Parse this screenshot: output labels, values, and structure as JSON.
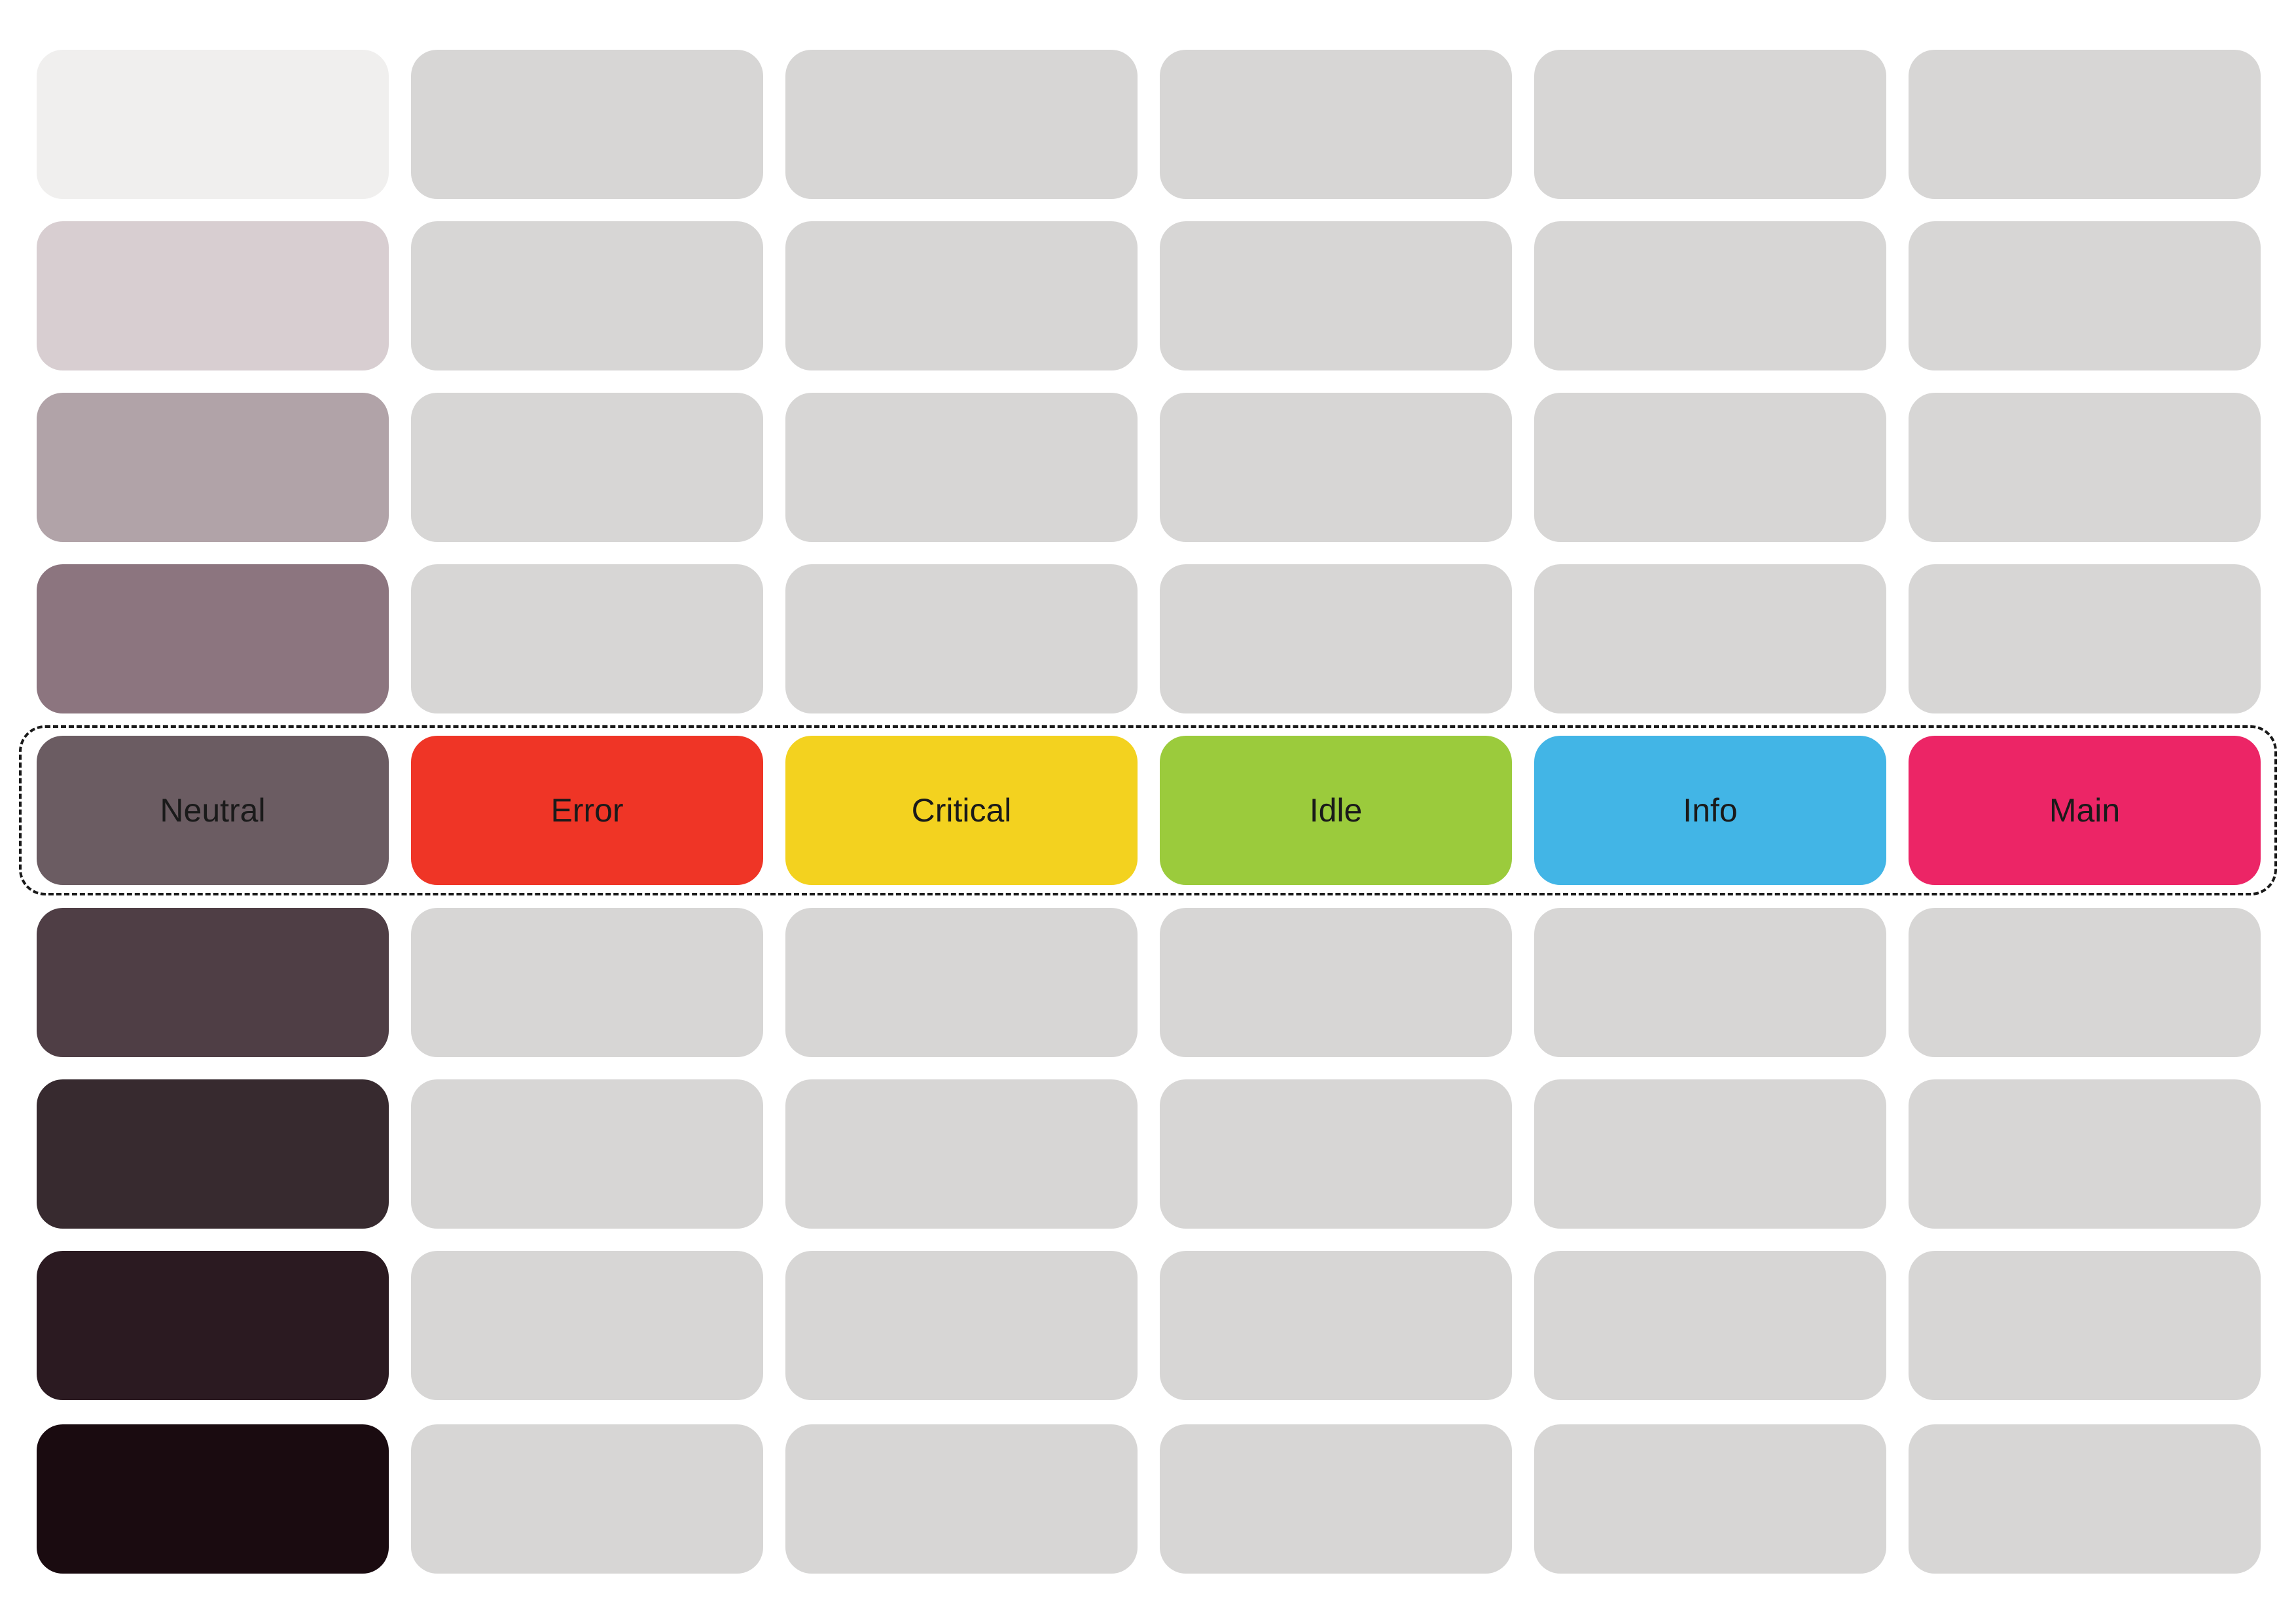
{
  "columns": [
    {
      "id": "neutral",
      "label": "Neutral",
      "shades": [
        "#f0efee",
        "#d8ced1",
        "#b1a3a8",
        "#8c757f",
        "#6b5c62",
        "#4f3e45",
        "#372a2f",
        "#2b1a21",
        "#1a0b10"
      ]
    },
    {
      "id": "error",
      "label": "Error",
      "shades": [
        "#d7d6d5",
        "#d7d6d5",
        "#d7d6d5",
        "#d7d6d5",
        "#ef3526",
        "#d7d6d5",
        "#d7d6d5",
        "#d7d6d5",
        "#d7d6d5"
      ]
    },
    {
      "id": "critical",
      "label": "Critical",
      "shades": [
        "#d7d6d5",
        "#d7d6d5",
        "#d7d6d5",
        "#d7d6d5",
        "#f3d21f",
        "#d7d6d5",
        "#d7d6d5",
        "#d7d6d5",
        "#d7d6d5"
      ]
    },
    {
      "id": "idle",
      "label": "Idle",
      "shades": [
        "#d7d6d5",
        "#d7d6d5",
        "#d7d6d5",
        "#d7d6d5",
        "#9bcb3c",
        "#d7d6d5",
        "#d7d6d5",
        "#d7d6d5",
        "#d7d6d5"
      ]
    },
    {
      "id": "info",
      "label": "Info",
      "shades": [
        "#d7d6d5",
        "#d7d6d5",
        "#d7d6d5",
        "#d7d6d5",
        "#42b5e6",
        "#d7d6d5",
        "#d7d6d5",
        "#d7d6d5",
        "#d7d6d5"
      ]
    },
    {
      "id": "main",
      "label": "Main",
      "shades": [
        "#d7d6d5",
        "#d7d6d5",
        "#d7d6d5",
        "#d7d6d5",
        "#ec2566",
        "#d7d6d5",
        "#d7d6d5",
        "#d7d6d5",
        "#d7d6d5"
      ]
    }
  ],
  "labeled_row": 5,
  "highlighted_row": 5
}
